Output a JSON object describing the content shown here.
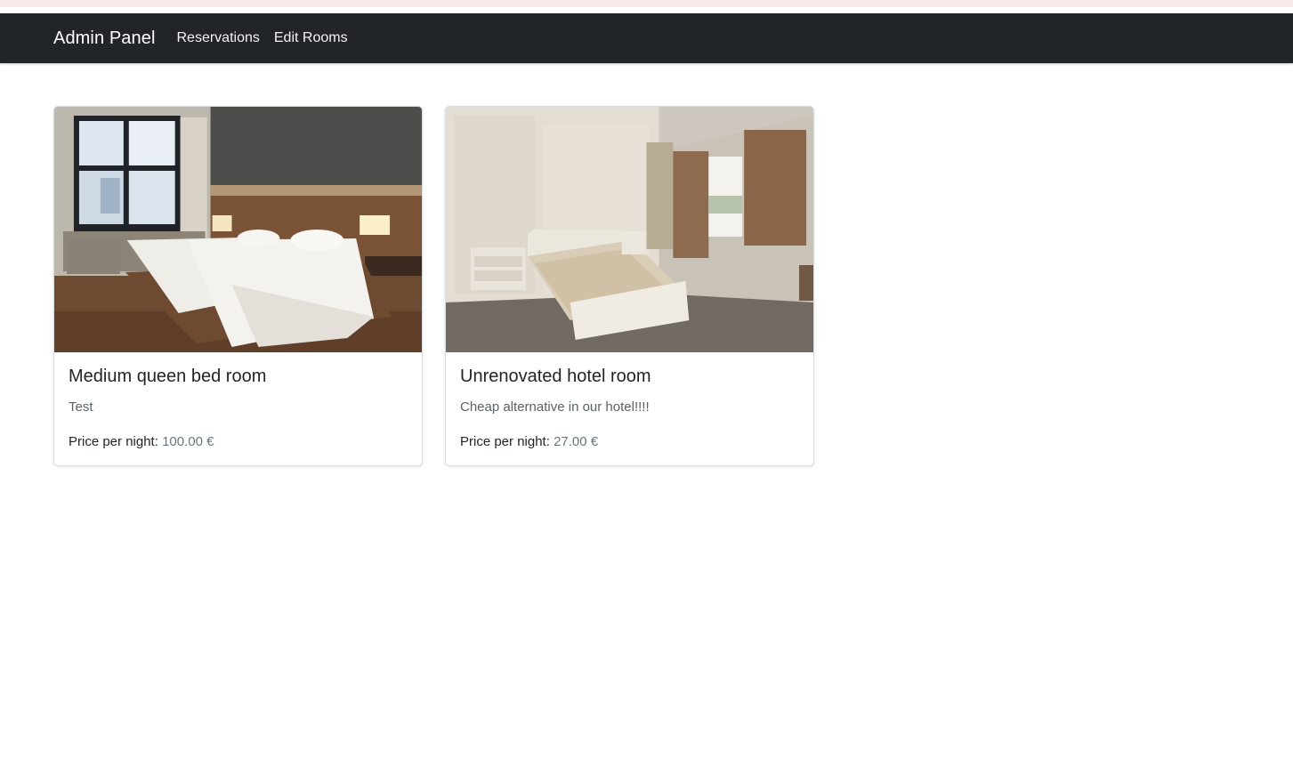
{
  "navbar": {
    "brand": "Admin Panel",
    "links": [
      {
        "label": "Reservations"
      },
      {
        "label": "Edit Rooms"
      }
    ]
  },
  "rooms": [
    {
      "title": "Medium queen bed room",
      "description": "Test",
      "price_label": "Price per night:",
      "price_value": "100.00 €",
      "image": "modern-hotel-room-photo"
    },
    {
      "title": "Unrenovated hotel room",
      "description": "Cheap alternative in our hotel!!!!",
      "price_label": "Price per night:",
      "price_value": "27.00 €",
      "image": "unrenovated-hotel-room-photo"
    }
  ],
  "colors": {
    "navbar_bg": "#212529",
    "top_strip": "#f8e9e7",
    "page_bg": "#ffffff"
  }
}
